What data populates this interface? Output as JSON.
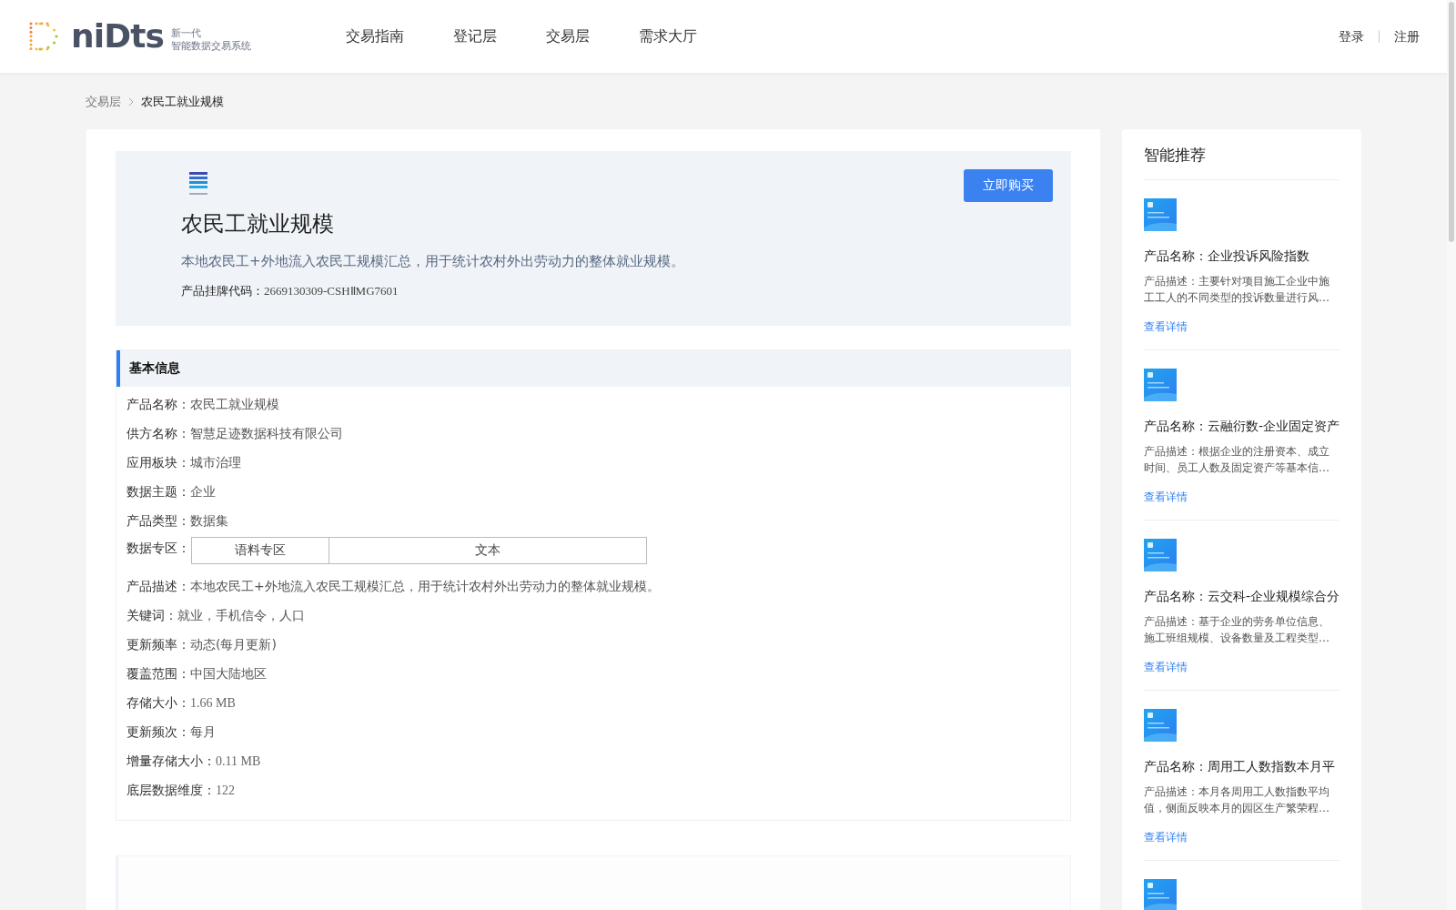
{
  "header": {
    "logo": {
      "word": "niDts",
      "tagline_1": "新一代",
      "tagline_2": "智能数据交易系统"
    },
    "nav": [
      {
        "label": "交易指南",
        "selected": false
      },
      {
        "label": "登记层",
        "selected": false
      },
      {
        "label": "交易层",
        "selected": false
      },
      {
        "label": "需求大厅",
        "selected": false
      }
    ],
    "auth": [
      "登录",
      "注册"
    ]
  },
  "breadcrumb": [
    "交易层",
    "农民工就业规模"
  ],
  "product": {
    "title": "农民工就业规模",
    "summary": "本地农民工+外地流入农民工规模汇总，用于统计农村外出劳动力的整体就业规模。",
    "code_label": "产品挂牌代码：",
    "code": "2669130309-CSHⅡMG7601",
    "buy_button": "立即购买"
  },
  "basic_info": {
    "title": "基本信息",
    "fields": [
      {
        "kind": "text",
        "label": "产品名称：",
        "value": "农民工就业规模"
      },
      {
        "kind": "text",
        "label": "供方名称：",
        "value": "智慧足迹数据科技有限公司"
      },
      {
        "kind": "text",
        "label": "应用板块：",
        "value": "城市治理"
      },
      {
        "kind": "text",
        "label": "数据主题：",
        "value": "企业"
      },
      {
        "kind": "text",
        "label": "产品类型：",
        "value": "数据集"
      },
      {
        "kind": "table",
        "label": "数据专区：",
        "cells": [
          "语料专区",
          "文本"
        ]
      },
      {
        "kind": "text",
        "label": "产品描述：",
        "value": "本地农民工+外地流入农民工规模汇总，用于统计农村外出劳动力的整体就业规模。"
      },
      {
        "kind": "text",
        "label": "关键词：",
        "value": "就业，手机信令，人口"
      },
      {
        "kind": "text",
        "label": "更新频率：",
        "value": "动态(每月更新)"
      },
      {
        "kind": "text",
        "label": "覆盖范围：",
        "value": "中国大陆地区"
      },
      {
        "kind": "mono",
        "label": "存储大小：",
        "value": "1.66 MB"
      },
      {
        "kind": "text",
        "label": "更新频次：",
        "value": "每月"
      },
      {
        "kind": "mono",
        "label": "增量存储大小：",
        "value": "0.11 MB"
      },
      {
        "kind": "mono",
        "label": "底层数据维度：",
        "value": "122"
      }
    ]
  },
  "recommendations": {
    "title": "智能推荐",
    "more_thumbnail": true,
    "items": [
      {
        "name": "产品名称：企业投诉风险指数",
        "description": "产品描述：主要针对项目施工企业中施工工人的不同类型的投诉数量进行风…",
        "link": "查看详情"
      },
      {
        "name": "产品名称：云融衍数-企业固定资产",
        "description": "产品描述：根据企业的注册资本、成立时间、员工人数及固定资产等基本信…",
        "link": "查看详情"
      },
      {
        "name": "产品名称：云交科-企业规模综合分",
        "description": "产品描述：基于企业的劳务单位信息、施工班组规模、设备数量及工程类型…",
        "link": "查看详情"
      },
      {
        "name": "产品名称：周用工人数指数本月平",
        "description": "产品描述：本月各周用工人数指数平均值，侧面反映本月的园区生产繁荣程…",
        "link": "查看详情"
      }
    ]
  }
}
